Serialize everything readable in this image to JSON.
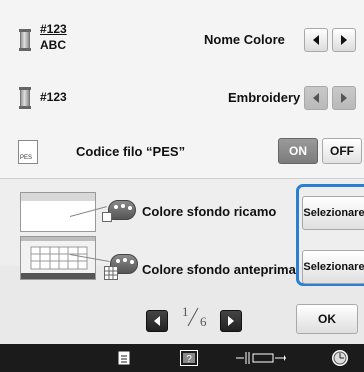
{
  "rows": {
    "name_row": {
      "code_top": "#123",
      "code_bottom": "ABC",
      "label": "Nome Colore"
    },
    "brand_row": {
      "code": "#123",
      "label": "Embroidery"
    },
    "pes_row": {
      "icon_text": "PES",
      "label": "Codice filo “PES”",
      "on_label": "ON",
      "off_label": "OFF",
      "state": "ON"
    }
  },
  "background": {
    "embroidery_label": "Colore sfondo ricamo",
    "preview_label": "Colore sfondo anteprima",
    "select_label": "Selezionare"
  },
  "pager": {
    "current": "1",
    "total": "6"
  },
  "ok_label": "OK",
  "colors": {
    "highlight": "#2a7fd4",
    "statusbar": "#1b1b1b"
  },
  "statusbar_icons": [
    "page-icon",
    "help-icon",
    "spacing-icon",
    "clock-icon"
  ]
}
